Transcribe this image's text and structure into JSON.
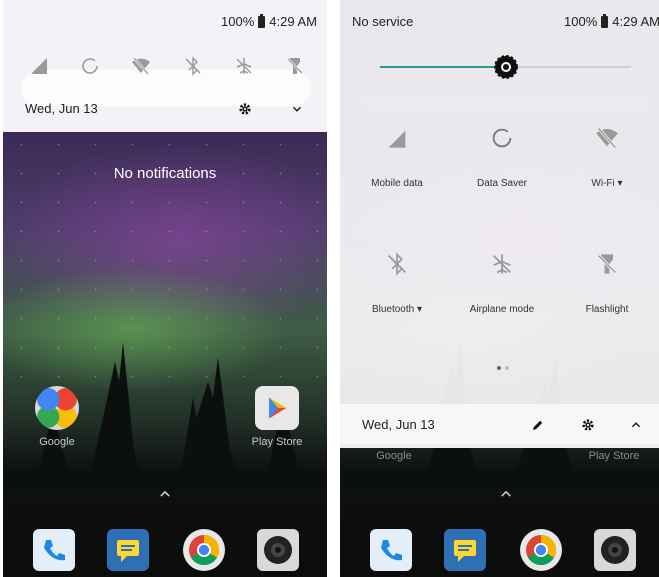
{
  "left": {
    "status": {
      "battery": "100%",
      "time": "4:29 AM"
    },
    "quick_icons": [
      "cell-signal-icon",
      "data-saver-icon",
      "wifi-off-icon",
      "bluetooth-off-icon",
      "airplane-off-icon",
      "flashlight-off-icon"
    ],
    "date": "Wed, Jun 13",
    "no_notifications": "No notifications",
    "apps": [
      {
        "label": "Google",
        "icon": "google-folder-icon"
      },
      {
        "label": "Play Store",
        "icon": "play-store-icon"
      }
    ],
    "dock": [
      "phone-icon",
      "messages-icon",
      "chrome-icon",
      "camera-icon"
    ]
  },
  "right": {
    "status": {
      "carrier": "No service",
      "battery": "100%",
      "time": "4:29 AM"
    },
    "brightness": 0.5,
    "tiles": [
      {
        "label": "Mobile data",
        "icon": "cell-signal-icon",
        "dropdown": false
      },
      {
        "label": "Data Saver",
        "icon": "data-saver-icon",
        "dropdown": false
      },
      {
        "label": "Wi-Fi",
        "icon": "wifi-off-icon",
        "dropdown": true
      },
      {
        "label": "Bluetooth",
        "icon": "bluetooth-off-icon",
        "dropdown": true
      },
      {
        "label": "Airplane mode",
        "icon": "airplane-off-icon",
        "dropdown": false
      },
      {
        "label": "Flashlight",
        "icon": "flashlight-off-icon",
        "dropdown": false
      }
    ],
    "date": "Wed, Jun 13",
    "apps": [
      {
        "label": "Google"
      },
      {
        "label": "Play Store"
      }
    ],
    "dock": [
      "phone-icon",
      "messages-icon",
      "chrome-icon",
      "camera-icon"
    ]
  },
  "colors": {
    "accent": "#2a9d8f",
    "shade": "#f4f2f6"
  }
}
